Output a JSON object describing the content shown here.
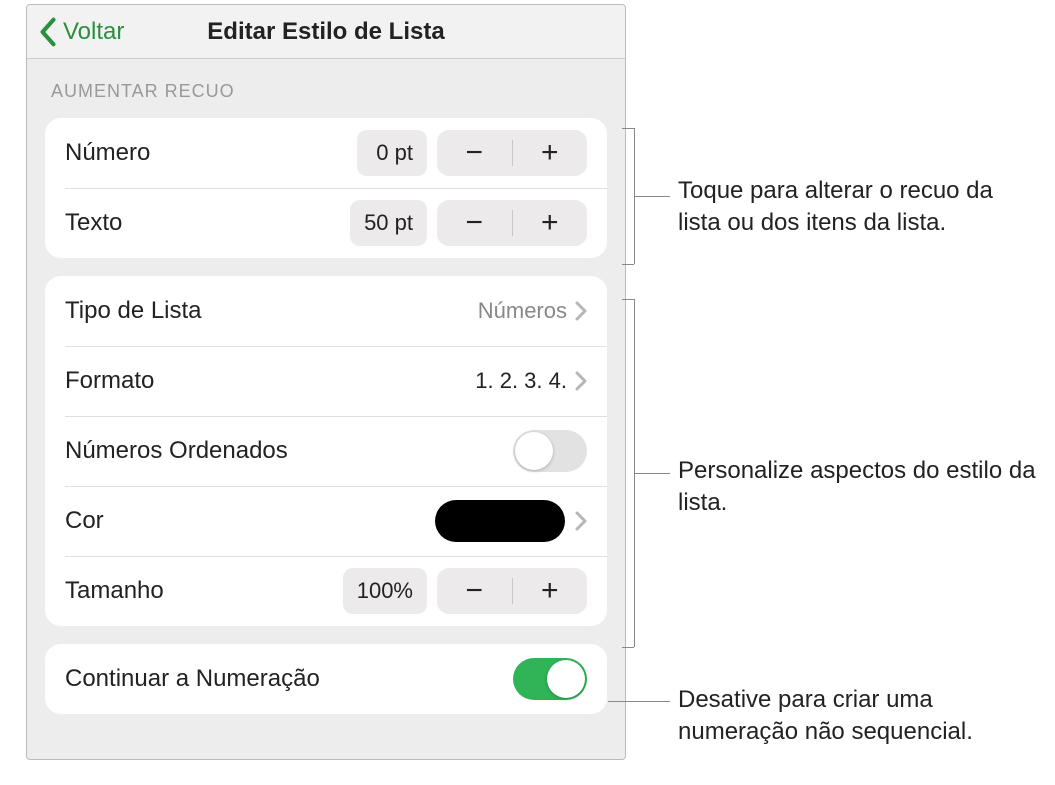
{
  "header": {
    "back_label": "Voltar",
    "title": "Editar Estilo de Lista"
  },
  "sections": {
    "indent_header": "AUMENTAR RECUO",
    "indent": {
      "numero": {
        "label": "Número",
        "value": "0 pt"
      },
      "texto": {
        "label": "Texto",
        "value": "50 pt"
      }
    },
    "style": {
      "tipo": {
        "label": "Tipo de Lista",
        "value": "Números"
      },
      "formato": {
        "label": "Formato",
        "value": "1. 2. 3. 4."
      },
      "ordenados": {
        "label": "Números Ordenados",
        "on": false
      },
      "cor": {
        "label": "Cor",
        "swatch": "#000000"
      },
      "tamanho": {
        "label": "Tamanho",
        "value": "100%"
      }
    },
    "continue": {
      "label": "Continuar a Numeração",
      "on": true
    }
  },
  "callouts": {
    "indent": "Toque para alterar o recuo da lista ou dos itens da lista.",
    "style": "Personalize aspectos do estilo da lista.",
    "continue": "Desative para criar uma numeração não sequencial."
  }
}
